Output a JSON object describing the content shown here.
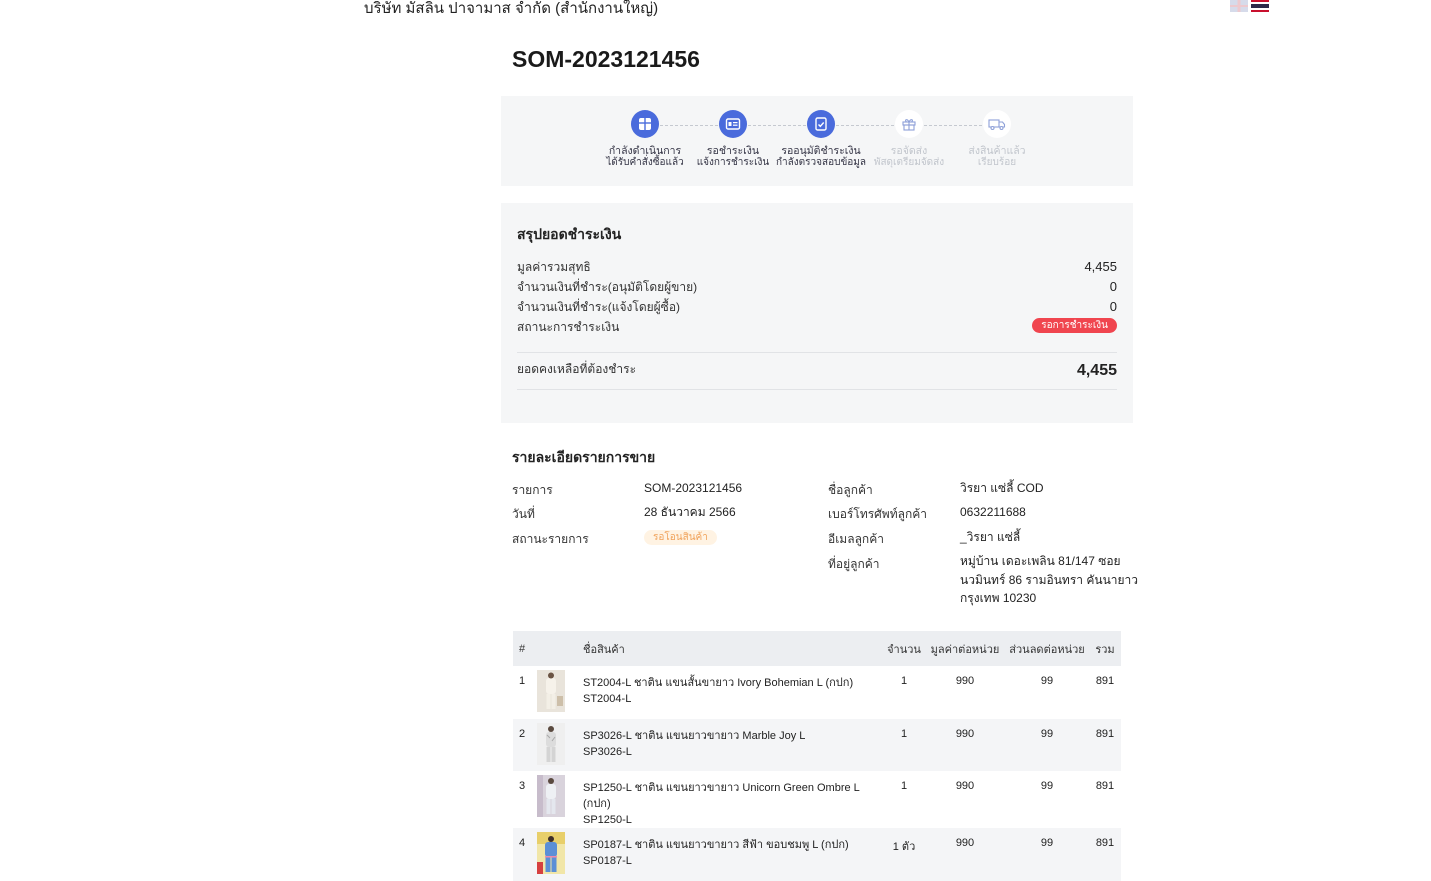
{
  "header": {
    "company_name": "บริษัท มัสลิน ปาจามาส จำกัด (สำนักงานใหญ่)",
    "languages": [
      "en",
      "th"
    ]
  },
  "order": {
    "number": "SOM-2023121456"
  },
  "progress": {
    "steps": [
      {
        "label": "กำลังดำเนินการ",
        "sub": "ได้รับคำสั่งซื้อแล้ว",
        "state": "done",
        "icon": "box-icon"
      },
      {
        "label": "รอชำระเงิน",
        "sub": "แจ้งการชำระเงิน",
        "state": "done",
        "icon": "id-card-icon"
      },
      {
        "label": "รออนุมัติชำระเงิน",
        "sub": "กำลังตรวจสอบข้อมูล",
        "state": "done",
        "icon": "clipboard-check-icon"
      },
      {
        "label": "รอจัดส่ง",
        "sub": "พัสดุเตรียมจัดส่ง",
        "state": "todo",
        "icon": "gift-icon"
      },
      {
        "label": "ส่งสินค้าแล้ว",
        "sub": "เรียบร้อย",
        "state": "todo",
        "icon": "truck-icon"
      }
    ]
  },
  "summary": {
    "title": "สรุปยอดชำระเงิน",
    "rows": [
      {
        "label": "มูลค่ารวมสุทธิ",
        "value": "4,455"
      },
      {
        "label": "จำนวนเงินที่ชำระ(อนุมัติโดยผู้ขาย)",
        "value": "0"
      },
      {
        "label": "จำนวนเงินที่ชำระ(แจ้งโดยผู้ซื้อ)",
        "value": "0"
      }
    ],
    "payment_status_label": "สถานะการชำระเงิน",
    "payment_status": "รอการชำระเงิน",
    "balance_label": "ยอดคงเหลือที่ต้องชำระ",
    "balance_value": "4,455",
    "colors": {
      "status_badge": "#f0454f"
    }
  },
  "details": {
    "title": "รายละเอียดรายการขาย",
    "order_label": "รายการ",
    "order_value": "SOM-2023121456",
    "date_label": "วันที่",
    "date_value": "28 ธันวาคม 2566",
    "status_label": "สถานะรายการ",
    "status_value": "รอโอนสินค้า",
    "customer_name_label": "ชื่อลูกค้า",
    "customer_name": "วิรยา แซ่ลี้ COD",
    "phone_label": "เบอร์โทรศัพท์ลูกค้า",
    "phone": "0632211688",
    "email_label": "อีเมลลูกค้า",
    "email": "_วิรยา แซ่ลี้",
    "address_label": "ที่อยู่ลูกค้า",
    "address_lines": [
      "หมู่บ้าน เดอะเพลิน 81/147 ซอย",
      "นวมินทร์ 86 รามอินทรา คันนายาว",
      "กรุงเทพ 10230"
    ]
  },
  "items": {
    "columns": [
      "#",
      "ชื่อสินค้า",
      "จำนวน",
      "มูลค่าต่อหน่วย",
      "ส่วนลดต่อหน่วย",
      "รวม"
    ],
    "rows": [
      {
        "no": "1",
        "name": "ST2004-L ชาติน แขนสั้นขายาว Ivory Bohemian L (กปก)",
        "sku": "ST2004-L",
        "qty": "1",
        "unit_price": "990",
        "discount": "99",
        "total": "891",
        "thumb": "thumb-ivory"
      },
      {
        "no": "2",
        "name": "SP3026-L ชาติน แขนยาวขายาว Marble Joy L",
        "sku": "SP3026-L",
        "qty": "1",
        "unit_price": "990",
        "discount": "99",
        "total": "891",
        "thumb": "thumb-marble"
      },
      {
        "no": "3",
        "name": "SP1250-L ชาติน แขนยาวขายาว Unicorn Green Ombre L (กปก)",
        "sku": "SP1250-L",
        "qty": "1",
        "unit_price": "990",
        "discount": "99",
        "total": "891",
        "thumb": "thumb-unicorn"
      },
      {
        "no": "4",
        "name": "SP0187-L ชาติน แขนยาวขายาว สีฟ้า ขอบชมพู L (กปก)",
        "sku": "SP0187-L",
        "qty": "1 ตัว",
        "unit_price": "990",
        "discount": "99",
        "total": "891",
        "thumb": "thumb-blue"
      }
    ]
  },
  "colors": {
    "accent": "#4a6bdc",
    "panel_bg": "#f5f6f7",
    "table_header_bg": "#eceef1",
    "order_status_badge": "#f0a25a"
  }
}
